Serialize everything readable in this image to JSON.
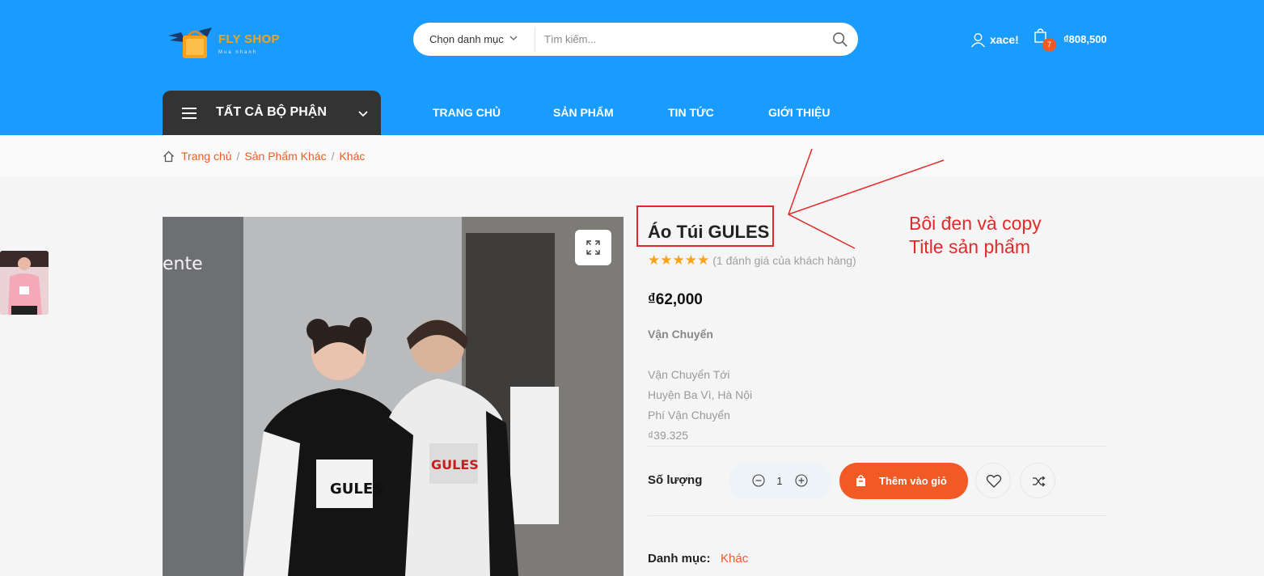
{
  "header": {
    "logo": {
      "title": "FLY SHOP",
      "tagline": "Mua nhanh"
    },
    "search": {
      "category_label": "Chọn danh mục",
      "placeholder": "Tìm kiếm..."
    },
    "account": {
      "username": "xace!"
    },
    "cart": {
      "count": "7",
      "total": "₫808,500"
    },
    "departments_label": "TẤT CẢ BỘ PHẬN",
    "nav": [
      "TRANG CHỦ",
      "SẢN PHẨM",
      "TIN TỨC",
      "GIỚI THIỆU"
    ]
  },
  "breadcrumb": [
    "Trang chủ",
    "Sản Phẩm Khác",
    "Khác"
  ],
  "product": {
    "title": "Áo Túi GULES",
    "rating": 5,
    "review_text": "(1 đánh giá của khách hàng)",
    "price": "₫62,000",
    "shipping": {
      "heading": "Vận Chuyển",
      "to_label": "Vận Chuyển Tới",
      "to_value": "Huyện Ba Vì, Hà Nội",
      "fee_label": "Phí Vận Chuyển",
      "fee_value": "₫39.325"
    },
    "quantity_label": "Số lượng",
    "quantity": "1",
    "add_to_cart": "Thêm vào giỏ",
    "category_label": "Danh mục:",
    "category_value": "Khác",
    "image_text": {
      "shop_sign": "ente",
      "hoodie_left": "GULES",
      "hoodie_right": "GULES"
    }
  },
  "annotation": {
    "line1": "Bôi đen và copy",
    "line2": "Title sản phẩm",
    "color": "#e32a2a"
  },
  "colors": {
    "header_blue": "#1a9cff",
    "accent_orange": "#f15a24",
    "dark_menu": "#333333",
    "star": "#f7a21b"
  }
}
